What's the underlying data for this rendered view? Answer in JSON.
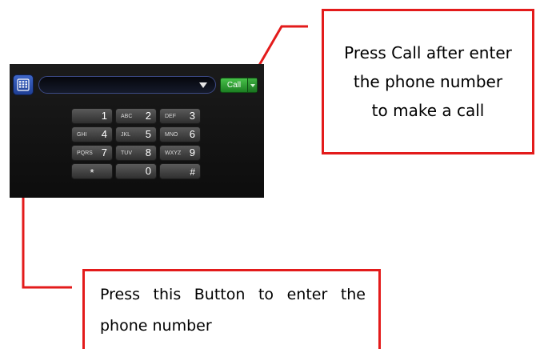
{
  "dialer": {
    "keypad_toggle_icon": "keypad-grid-icon",
    "number_field": {
      "value": "",
      "dropdown_icon": "chevron-down-icon"
    },
    "call_button": {
      "label": "Call",
      "split_icon": "chevron-down-icon",
      "color": "#2e9e33"
    },
    "keys": [
      {
        "letters": "",
        "digit": "1"
      },
      {
        "letters": "ABC",
        "digit": "2"
      },
      {
        "letters": "DEF",
        "digit": "3"
      },
      {
        "letters": "GHI",
        "digit": "4"
      },
      {
        "letters": "JKL",
        "digit": "5"
      },
      {
        "letters": "MNO",
        "digit": "6"
      },
      {
        "letters": "PQRS",
        "digit": "7"
      },
      {
        "letters": "TUV",
        "digit": "8"
      },
      {
        "letters": "WXYZ",
        "digit": "9"
      },
      {
        "letters": "",
        "digit": "*"
      },
      {
        "letters": "",
        "digit": "0"
      },
      {
        "letters": "",
        "digit": "#"
      }
    ]
  },
  "callouts": {
    "call": "Press Call after enter the phone number to make a call",
    "keypad": "Press this Button to enter the phone number",
    "border_color": "#e31b1b"
  }
}
